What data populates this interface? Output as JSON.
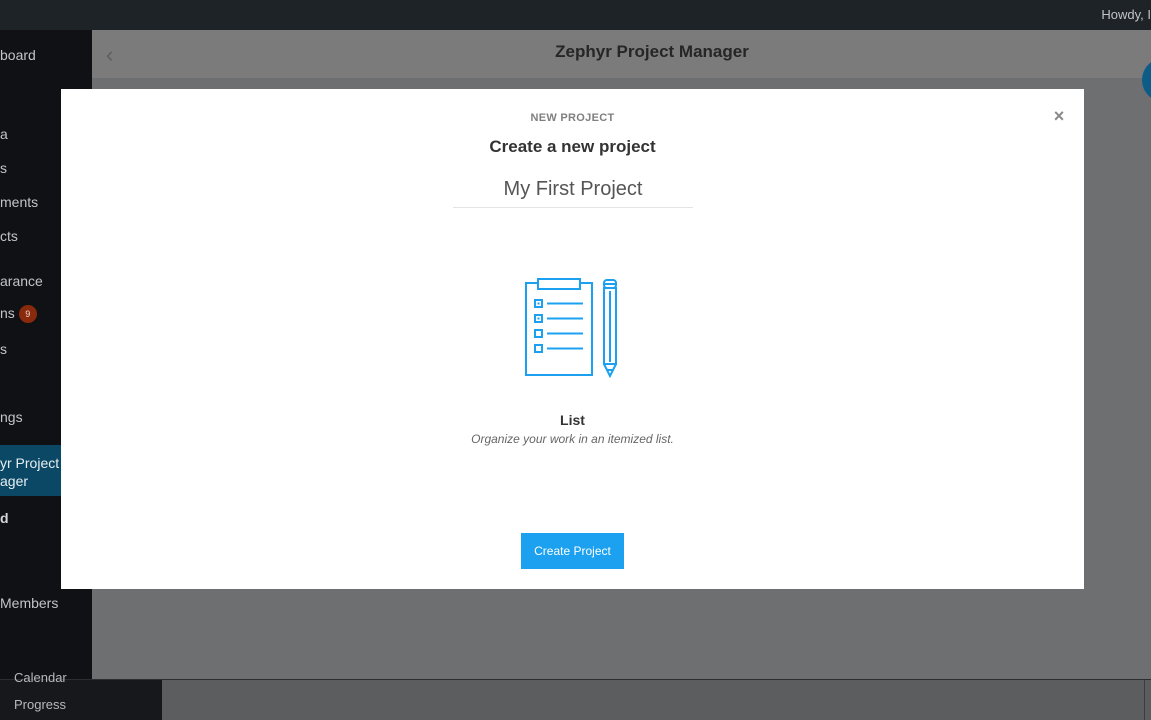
{
  "admin_bar": {
    "howdy": "Howdy, I"
  },
  "sidebar": {
    "items": [
      {
        "label": "board"
      },
      {
        "label": "a"
      },
      {
        "label": "s"
      },
      {
        "label": "ments"
      },
      {
        "label": "cts"
      },
      {
        "label": "arance"
      },
      {
        "label": "ns",
        "badge": "9"
      },
      {
        "label": "s"
      },
      {
        "label": "ngs"
      }
    ],
    "active_line1": "yr Project",
    "active_line2": "ager",
    "bold_item": "d",
    "members": "Members",
    "sub_calendar": "Calendar",
    "sub_progress": "Progress"
  },
  "plugin_header": {
    "title": "Zephyr Project Manager"
  },
  "modal": {
    "kicker": "NEW PROJECT",
    "heading": "Create a new project",
    "name_value": "My First Project",
    "type_title": "List",
    "type_description": "Organize your work in an itemized list.",
    "submit_label": "Create Project",
    "close_glyph": "×",
    "illustration_icon": "clipboard-list-pencil-icon",
    "accent_color": "#1ba1f0"
  }
}
